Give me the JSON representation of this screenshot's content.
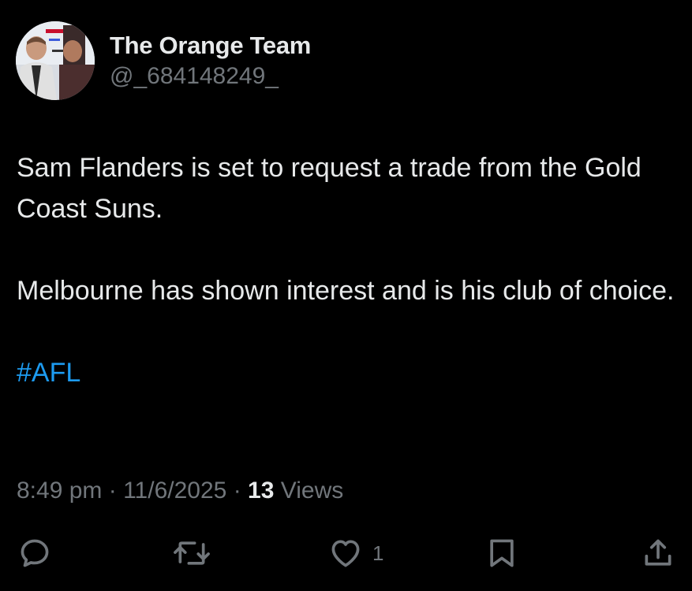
{
  "post": {
    "display_name": "The Orange Team",
    "handle": "@_684148249_",
    "text_paragraph_1": "Sam Flanders is set to request a trade from the Gold Coast Suns.",
    "text_paragraph_2": "Melbourne has shown interest and is his club of choice.",
    "hashtag": "#AFL",
    "time": "8:49 pm",
    "separator": "·",
    "date": "11/6/2025",
    "views_count": "13",
    "views_label": "Views"
  },
  "actions": {
    "reply_icon": "reply-icon",
    "repost_icon": "repost-icon",
    "like_icon": "heart-icon",
    "like_count": "1",
    "bookmark_icon": "bookmark-icon",
    "share_icon": "share-icon"
  },
  "colors": {
    "background": "#000000",
    "primary_text": "#e7e9ea",
    "secondary_text": "#71767b",
    "link": "#1d9bf0"
  }
}
